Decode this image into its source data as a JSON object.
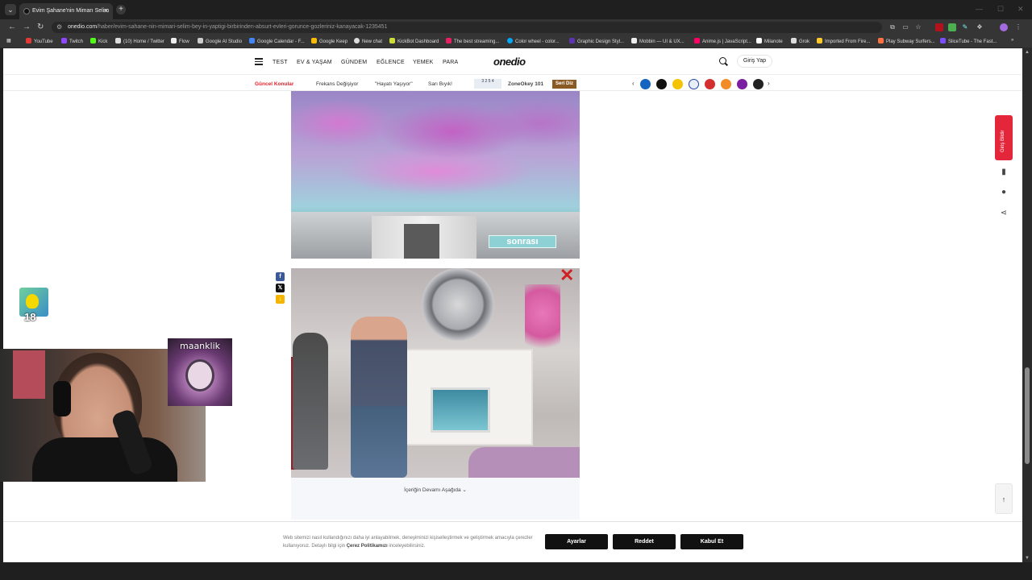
{
  "browser": {
    "tab_title": "Evim Şahane'nin Mimarı Selim",
    "url_host": "onedio.com",
    "url_path": "/haber/evim-sahane-nin-mimari-selim-bey-in-yaptigi-birbirinden-absurt-evleri-gorunce-gozleriniz-kanayacak-1235451",
    "bookmarks": [
      "YouTube",
      "Twitch",
      "Kick",
      "(10) Home / Twitter",
      "Flow",
      "Google AI Studio",
      "Google Calendar - F...",
      "Google Keep",
      "New chat",
      "KickBot Dashboard",
      "The best streaming...",
      "Color wheel - color...",
      "Graphic Design Styl...",
      "Mobbin — UI & UX...",
      "Anime.js | JavaScript...",
      "Milanote",
      "Grok",
      "Imported From Fire...",
      "Play Subway Surfers...",
      "SliceTube - The Fast..."
    ]
  },
  "site": {
    "logo": "onedio",
    "nav": [
      "TEST",
      "EV & YAŞAM",
      "GÜNDEM",
      "EĞLENCE",
      "YEMEK",
      "PARA"
    ],
    "login": "Giriş Yap",
    "topics_label": "Güncel Konular",
    "topics": [
      "Frekans Değişiyor",
      "\"Hayatı Yaşıyor\"",
      "Sarı Bıyık!"
    ],
    "lotto_numbers": "3 2 5 4",
    "zoneokey": "ZoneOkey 101",
    "seri_diz": "Seri Diz",
    "image1_tag": "sonrası",
    "more_content": "İçeriğin Devamı Aşağıda ⌄",
    "side_login": "Giriş Bildir",
    "cookie_text_1": "Web sitemizi nasıl kullandığınızı daha iyi anlayabilmek, deneyiminizi kişiselleştirmek ve geliştirmek amacıyla çerezler kullanıyoruz. Detaylı bilgi için ",
    "cookie_link": "Çerez Politikamızı",
    "cookie_text_2": " inceleyebilirsiniz.",
    "btn_settings": "Ayarlar",
    "btn_reject": "Reddet",
    "btn_accept": "Kabul Et"
  },
  "overlay": {
    "counter": "18",
    "cam_name": "maanklik"
  },
  "colors": {
    "accent_red": "#e3263a",
    "seri_brown": "#8a5a23"
  }
}
